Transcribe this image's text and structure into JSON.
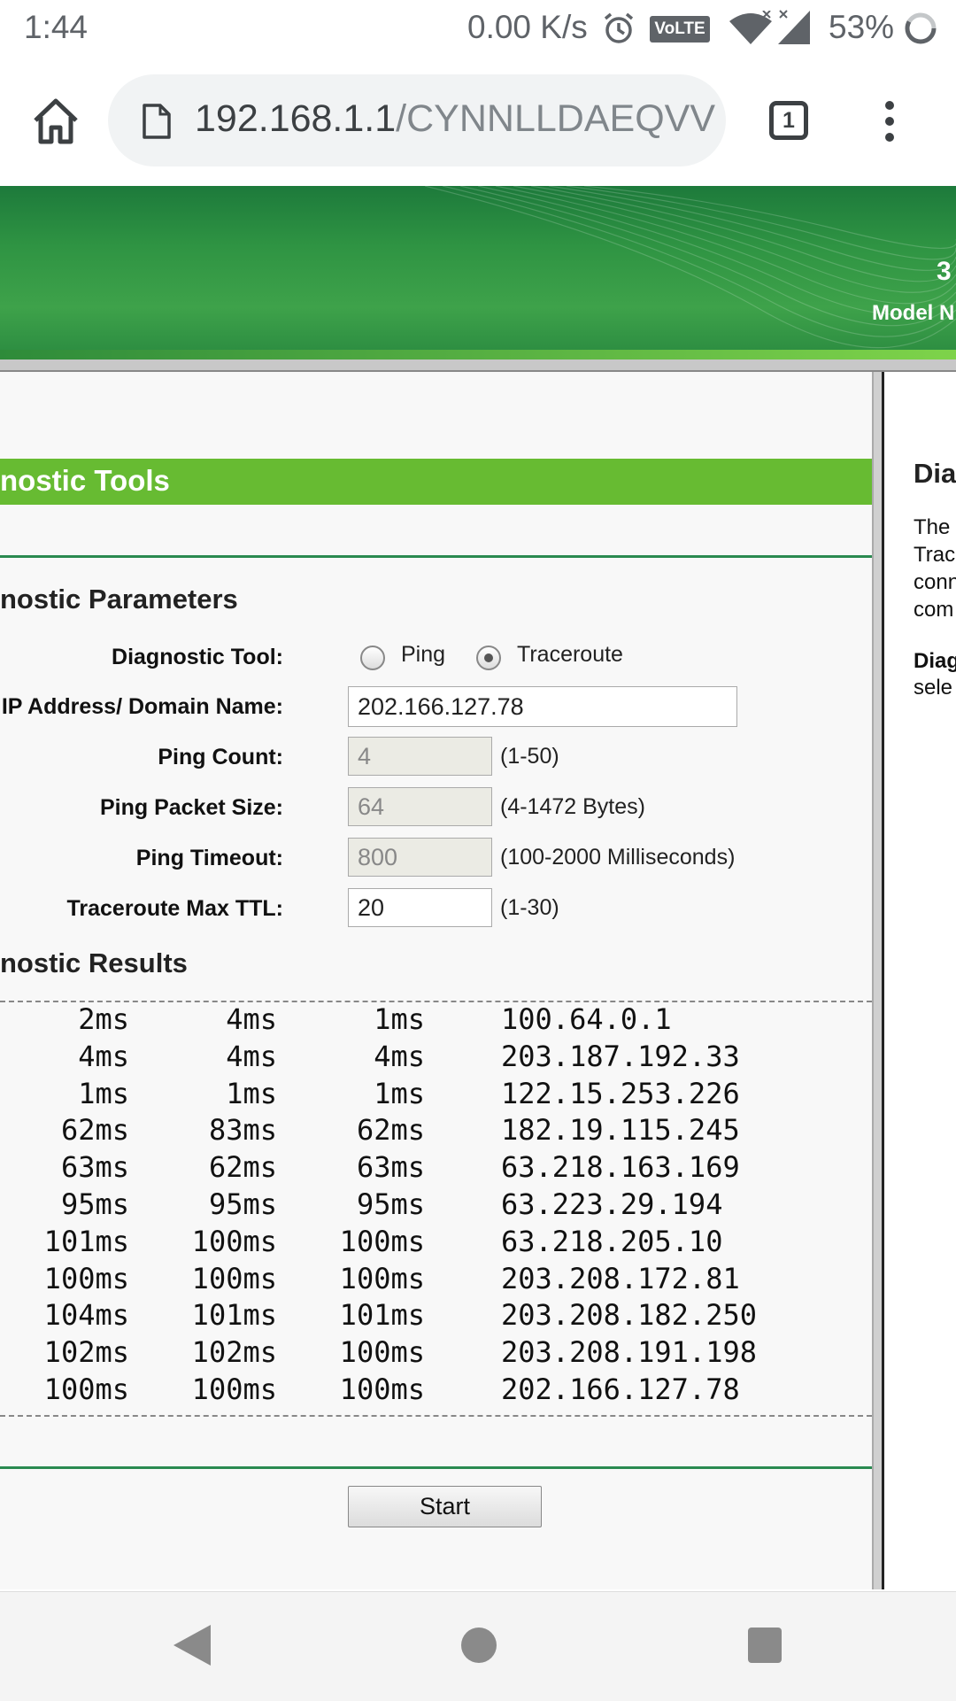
{
  "status_bar": {
    "time": "1:44",
    "network_speed": "0.00 K/s",
    "volte": "VoLTE",
    "battery": "53%"
  },
  "browser": {
    "url_host": "192.168.1.1",
    "url_path": "/CYNNLLDAEQVV",
    "tab_count": "1"
  },
  "router_header": {
    "number": "3",
    "model_label": "Model N"
  },
  "page": {
    "section_title": "nostic Tools",
    "parameters_heading": "nostic Parameters",
    "results_heading": "nostic Results",
    "start_label": "Start"
  },
  "form": {
    "diagnostic_tool_label": "Diagnostic Tool:",
    "ping_option": "Ping",
    "traceroute_option": "Traceroute",
    "selected_tool": "Traceroute",
    "ip_label": "IP Address/ Domain Name:",
    "ip_value": "202.166.127.78",
    "ping_count_label": "Ping Count:",
    "ping_count_value": "4",
    "ping_count_hint": "(1-50)",
    "packet_size_label": "Ping Packet Size:",
    "packet_size_value": "64",
    "packet_size_hint": "(4-1472 Bytes)",
    "timeout_label": "Ping Timeout:",
    "timeout_value": "800",
    "timeout_hint": "(100-2000 Milliseconds)",
    "ttl_label": "Traceroute Max TTL:",
    "ttl_value": "20",
    "ttl_hint": "(1-30)"
  },
  "results": [
    {
      "t1": "2ms",
      "t2": "4ms",
      "t3": "1ms",
      "ip": "100.64.0.1"
    },
    {
      "t1": "4ms",
      "t2": "4ms",
      "t3": "4ms",
      "ip": "203.187.192.33"
    },
    {
      "t1": "1ms",
      "t2": "1ms",
      "t3": "1ms",
      "ip": "122.15.253.226"
    },
    {
      "t1": "62ms",
      "t2": "83ms",
      "t3": "62ms",
      "ip": "182.19.115.245"
    },
    {
      "t1": "63ms",
      "t2": "62ms",
      "t3": "63ms",
      "ip": "63.218.163.169"
    },
    {
      "t1": "95ms",
      "t2": "95ms",
      "t3": "95ms",
      "ip": "63.223.29.194"
    },
    {
      "t1": "101ms",
      "t2": "100ms",
      "t3": "100ms",
      "ip": "63.218.205.10"
    },
    {
      "t1": "100ms",
      "t2": "100ms",
      "t3": "100ms",
      "ip": "203.208.172.81"
    },
    {
      "t1": "104ms",
      "t2": "101ms",
      "t3": "101ms",
      "ip": "203.208.182.250"
    },
    {
      "t1": "102ms",
      "t2": "102ms",
      "t3": "100ms",
      "ip": "203.208.191.198"
    },
    {
      "t1": "100ms",
      "t2": "100ms",
      "t3": "100ms",
      "ip": "202.166.127.78"
    }
  ],
  "help": {
    "title": "Dia",
    "lines": [
      "The",
      "Trac",
      "conn",
      "com"
    ],
    "bold_line": "Diag",
    "last_line": "sele"
  }
}
